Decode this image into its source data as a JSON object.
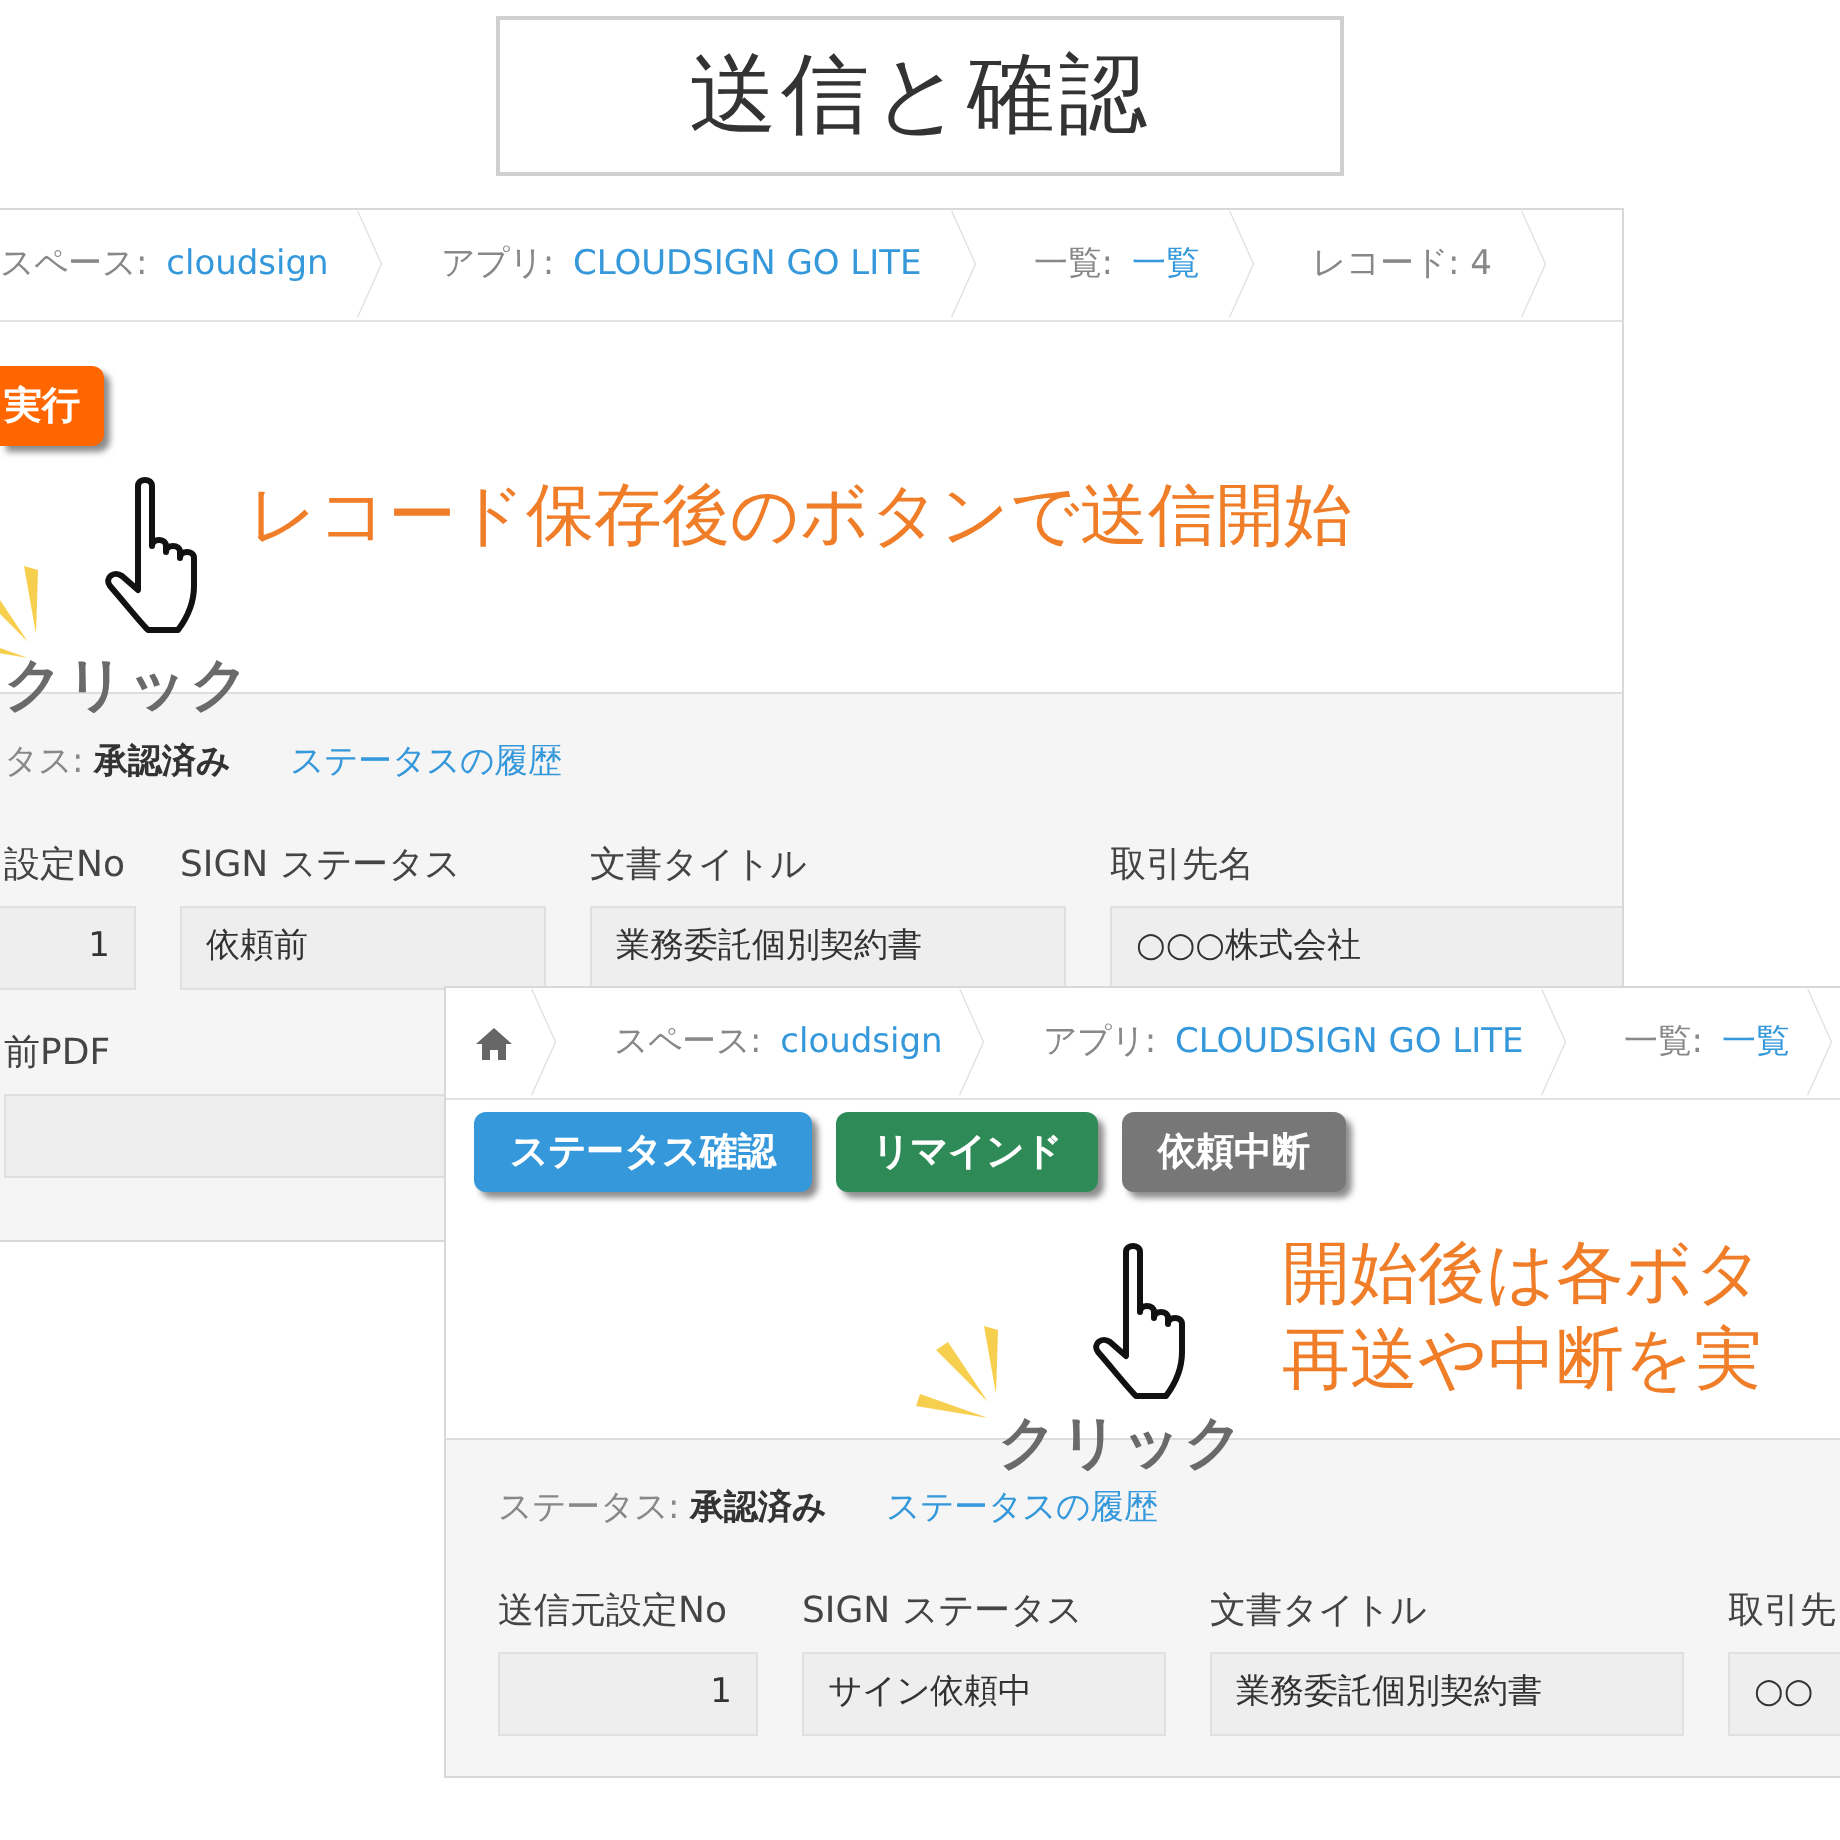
{
  "title": "送信と確認",
  "screens": [
    {
      "breadcrumbs": [
        {
          "kind": "link",
          "label": "スペース: ",
          "value": "cloudsign"
        },
        {
          "kind": "link",
          "label": "アプリ: ",
          "value": "CLOUDSIGN GO LITE"
        },
        {
          "kind": "link",
          "label": "一覧: ",
          "value": "一覧"
        },
        {
          "kind": "text",
          "label": "レコード: ",
          "value": "4"
        }
      ],
      "buttons": [
        {
          "label": "実行",
          "color": "#ff6600"
        }
      ],
      "annotation": [
        "レコード保存後のボタンで送信開始"
      ],
      "click_label": "クリック",
      "status": "タス: **承認済み**",
      "history_link": "ステータスの履歴",
      "fields": [
        {
          "label": "設定No",
          "value": "1"
        },
        {
          "label": "SIGN ステータス",
          "value": "依頼前"
        },
        {
          "label": "文書タイトル",
          "value": "業務委託個別契約書"
        },
        {
          "label": "取引先名",
          "value": "○○○株式会社"
        }
      ],
      "extra_fields": [
        {
          "label": "前PDF"
        }
      ]
    },
    {
      "breadcrumbs": [
        {
          "kind": "home"
        },
        {
          "kind": "link",
          "label": "スペース: ",
          "value": "cloudsign"
        },
        {
          "kind": "link",
          "label": "アプリ: ",
          "value": "CLOUDSIGN GO LITE"
        },
        {
          "kind": "link",
          "label": "一覧: ",
          "value": "一覧"
        }
      ],
      "buttons": [
        {
          "label": "ステータス確認",
          "color": "#3498db"
        },
        {
          "label": "リマインド",
          "color": "#2e8b57"
        },
        {
          "label": "依頼中断",
          "color": "#777777"
        }
      ],
      "annotation": [
        "開始後は各ボタ",
        "再送や中断を実"
      ],
      "click_label": "クリック",
      "status": "ステータス: **承認済み**",
      "history_link": "ステータスの履歴",
      "fields": [
        {
          "label": "送信元設定No",
          "value": "1"
        },
        {
          "label": "SIGN ステータス",
          "value": "サイン依頼中"
        },
        {
          "label": "文書タイトル",
          "value": "業務委託個別契約書"
        },
        {
          "label": "取引先",
          "value": "○○"
        }
      ]
    }
  ]
}
